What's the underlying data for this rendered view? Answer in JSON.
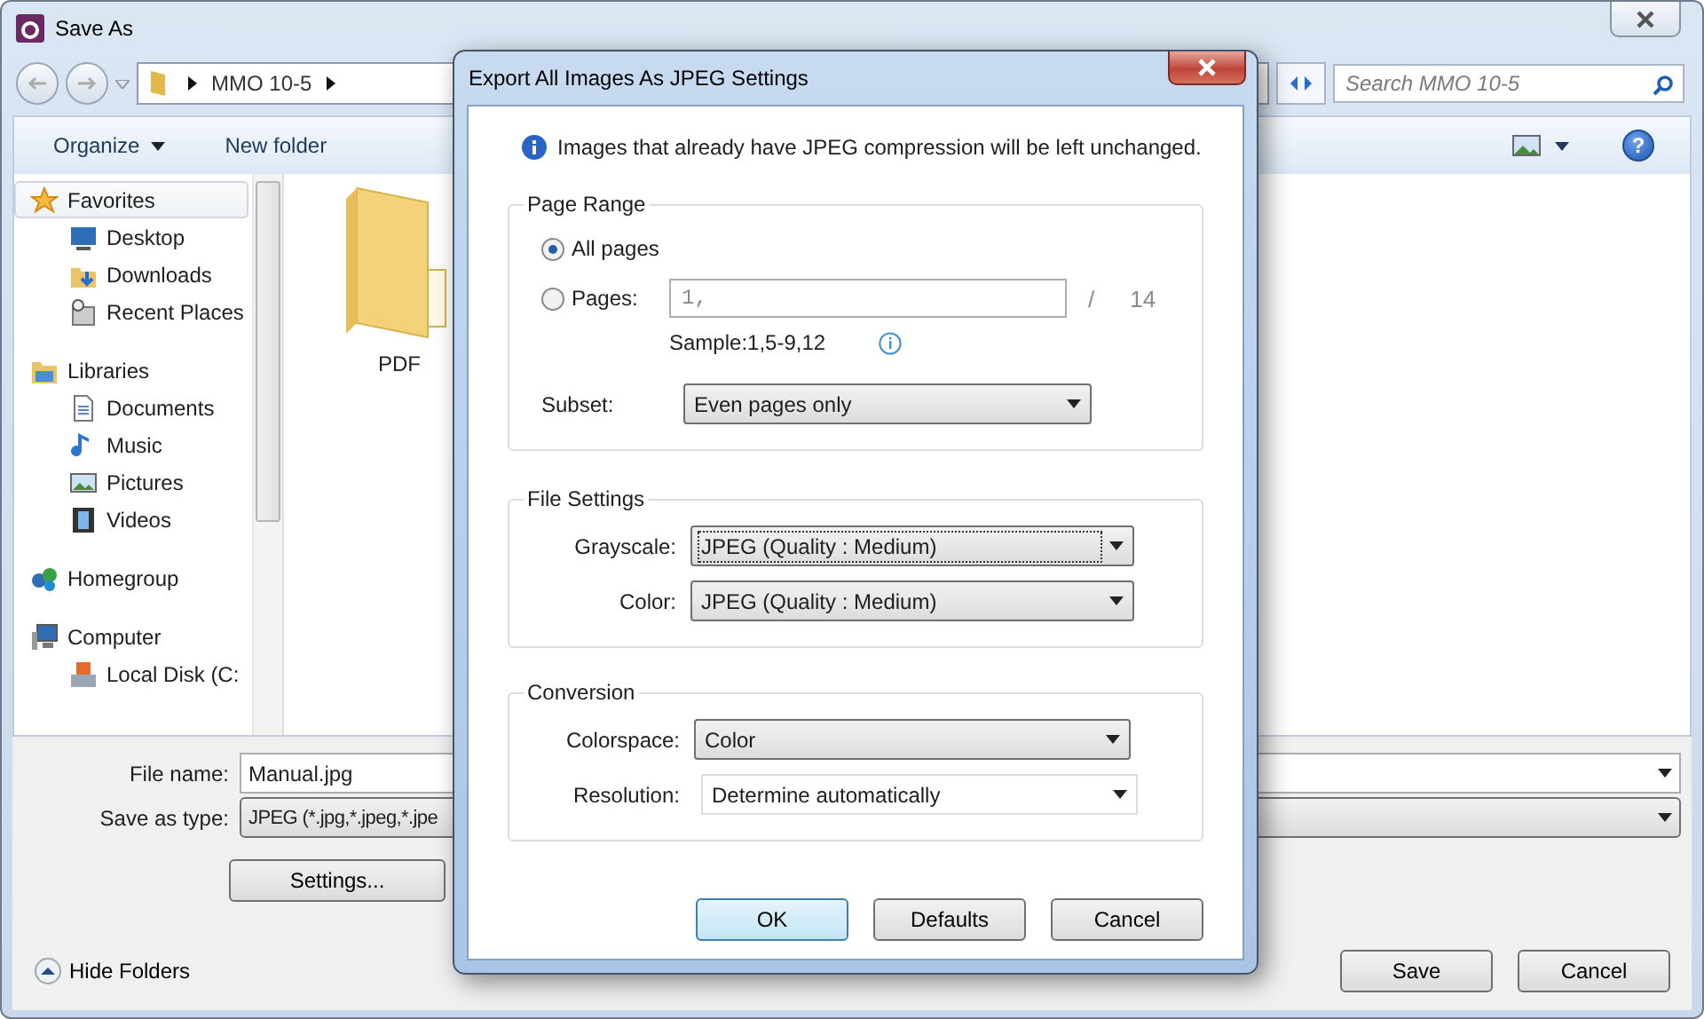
{
  "save_dialog": {
    "title": "Save As",
    "address": {
      "crumbs": [
        "MMO 10-5"
      ]
    },
    "search": {
      "placeholder": "Search MMO 10-5"
    },
    "toolbar": [
      {
        "label": "Organize",
        "has_menu": true
      },
      {
        "label": "New folder",
        "has_menu": false
      }
    ],
    "nav_tree": [
      {
        "label": "Favorites",
        "kind": "star",
        "selected": true,
        "children": [
          {
            "label": "Desktop",
            "kind": "desktop",
            "selected": false
          },
          {
            "label": "Downloads",
            "kind": "downloads",
            "selected": false
          },
          {
            "label": "Recent Places",
            "kind": "recent",
            "selected": false
          }
        ]
      },
      {
        "label": "Libraries",
        "kind": "libraries",
        "selected": false,
        "children": [
          {
            "label": "Documents",
            "kind": "documents",
            "selected": false
          },
          {
            "label": "Music",
            "kind": "music",
            "selected": false
          },
          {
            "label": "Pictures",
            "kind": "pictures",
            "selected": false
          },
          {
            "label": "Videos",
            "kind": "videos",
            "selected": false
          }
        ]
      },
      {
        "label": "Homegroup",
        "kind": "homegroup",
        "selected": false
      },
      {
        "label": "Computer",
        "kind": "computer",
        "selected": false,
        "children": [
          {
            "label": "Local Disk (C:",
            "kind": "disk",
            "selected": false
          }
        ]
      }
    ],
    "files": [
      {
        "name": "PDF"
      }
    ],
    "file_name": {
      "label": "File name:",
      "value": "Manual.jpg"
    },
    "save_type": {
      "label": "Save as type:",
      "value": "JPEG (*.jpg,*.jpeg,*.jpe"
    },
    "settings_button": "Settings...",
    "help_button": "?",
    "hide_folders": "Hide Folders",
    "buttons": [
      "Save",
      "Cancel"
    ]
  },
  "export_dialog": {
    "title": "Export All Images As JPEG Settings",
    "info": "Images that already have JPEG compression will be left unchanged.",
    "page_range": {
      "title": "Page Range",
      "options": [
        {
          "label": "All pages",
          "selected": true
        },
        {
          "label": "Pages:",
          "selected": false
        }
      ],
      "pages_field": {
        "value": "1,",
        "disabled": true
      },
      "separator": "/",
      "total": "14",
      "sample": "Sample:1,5-9,12",
      "subset": {
        "label": "Subset:",
        "value": "Even pages only",
        "kind": "list",
        "focused": false
      }
    },
    "file_settings": {
      "title": "File Settings",
      "rows": [
        {
          "label": "Grayscale:",
          "value": "JPEG (Quality : Medium)",
          "kind": "list",
          "focused": true
        },
        {
          "label": "Color:",
          "value": "JPEG (Quality : Medium)",
          "kind": "list",
          "focused": false
        }
      ]
    },
    "conversion": {
      "title": "Conversion",
      "rows": [
        {
          "label": "Colorspace:",
          "value": "Color",
          "kind": "list",
          "focused": false
        },
        {
          "label": "Resolution:",
          "value": "Determine automatically",
          "kind": "combo",
          "focused": false
        }
      ]
    },
    "buttons": [
      {
        "label": "OK",
        "default": true
      },
      {
        "label": "Defaults",
        "default": false
      },
      {
        "label": "Cancel",
        "default": false
      }
    ]
  }
}
